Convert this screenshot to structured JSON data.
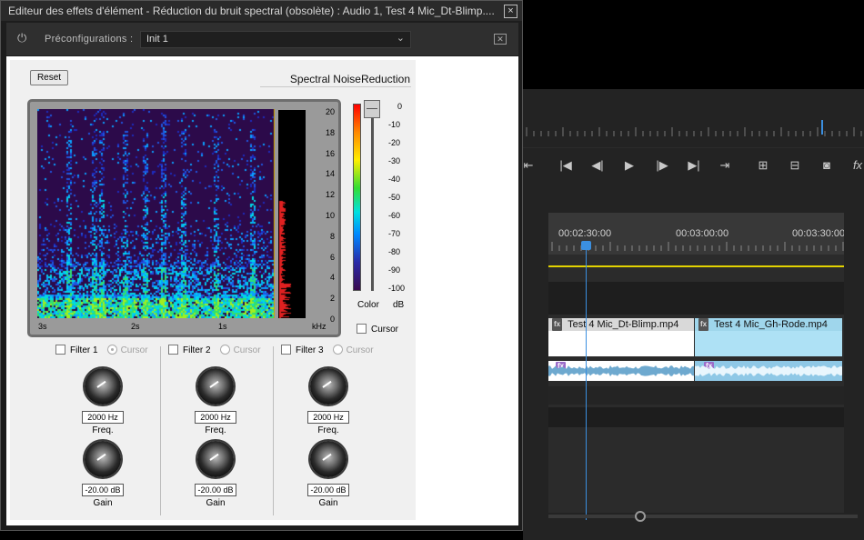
{
  "dialog": {
    "title": "Editeur des effets d'élément - Réduction du bruit spectral (obsolète) : Audio 1, Test 4 Mic_Dt-Blimp....",
    "close_glyph": "×",
    "power_icon": "power-icon",
    "preset_label": "Préconfigurations :",
    "preset_value": "Init 1"
  },
  "plugin": {
    "reset_label": "Reset",
    "name": "Spectral NoiseReduction",
    "freq_ticks": [
      "20",
      "18",
      "16",
      "14",
      "12",
      "10",
      "8",
      "6",
      "4",
      "2",
      "0"
    ],
    "freq_unit": "kHz",
    "time_ticks": [
      "3s",
      "2s",
      "1s"
    ],
    "db_ticks": [
      "0",
      "-10",
      "-20",
      "-30",
      "-40",
      "-50",
      "-60",
      "-70",
      "-80",
      "-90",
      "-100"
    ],
    "color_label": "Color",
    "db_label": "dB",
    "cursor_label": "Cursor"
  },
  "filters": [
    {
      "label": "Filter 1",
      "cursor": "Cursor",
      "freq_value": "2000 Hz",
      "freq_label": "Freq.",
      "gain_value": "-20.00 dB",
      "gain_label": "Gain"
    },
    {
      "label": "Filter 2",
      "cursor": "Cursor",
      "freq_value": "2000 Hz",
      "freq_label": "Freq.",
      "gain_value": "-20.00 dB",
      "gain_label": "Gain"
    },
    {
      "label": "Filter 3",
      "cursor": "Cursor",
      "freq_value": "2000 Hz",
      "freq_label": "Freq.",
      "gain_value": "-20.00 dB",
      "gain_label": "Gain"
    }
  ],
  "timeline": {
    "timecodes": [
      "00:02:30:00",
      "00:03:00:00",
      "00:03:30:00"
    ],
    "clip1": "Test 4 Mic_Dt-Blimp.mp4",
    "clip2": "Test 4 Mic_Gh-Rode.mp4",
    "fx_badge": "fx",
    "accent": "#3b8fe0"
  }
}
